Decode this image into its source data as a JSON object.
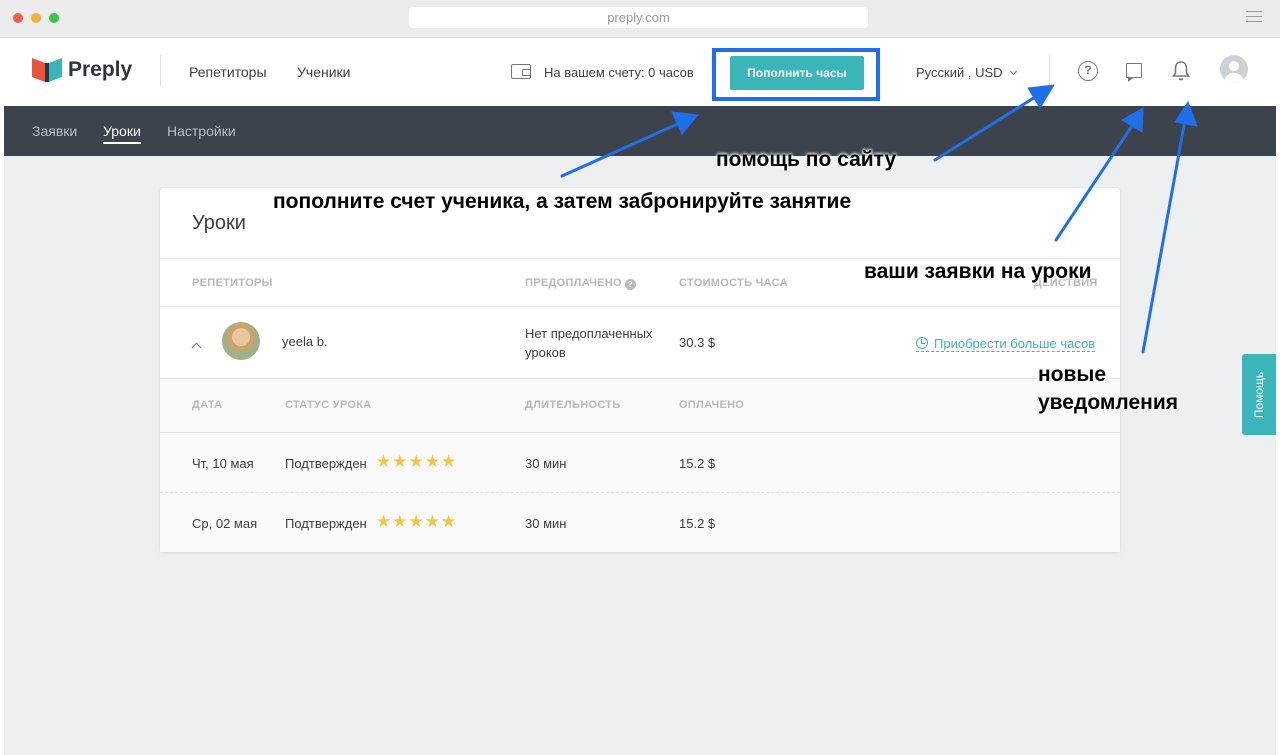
{
  "browser": {
    "url": "preply.com"
  },
  "header": {
    "logo_text": "Preply",
    "nav": [
      "Репетиторы",
      "Ученики"
    ],
    "balance_text": "На вашем счету: 0 часов",
    "topup_label": "Пополнить часы",
    "language": "Русский , USD",
    "help_symbol": "?"
  },
  "subnav": {
    "tabs": [
      {
        "label": "Заявки",
        "active": false
      },
      {
        "label": "Уроки",
        "active": true
      },
      {
        "label": "Настройки",
        "active": false
      }
    ]
  },
  "lessons": {
    "title": "Уроки",
    "columns": {
      "tutors": "РЕПЕТИТОРЫ",
      "prepaid": "ПРЕДОПЛАЧЕНО",
      "hour_cost": "СТОИМОСТЬ ЧАСА",
      "actions": "ДЕЙСТВИЯ"
    },
    "tutor": {
      "name": "yeela b.",
      "prepaid": "Нет предоплаченных уроков",
      "hour_cost": "30.3 $",
      "action": "Приобрести больше часов"
    },
    "sub_columns": {
      "date": "ДАТА",
      "status": "СТАТУС УРОКА",
      "duration": "ДЛИТЕЛЬНОСТЬ",
      "paid": "ОПЛАЧЕНО"
    },
    "rows": [
      {
        "date": "Чт, 10 мая",
        "status": "Подтвержден",
        "rating": 5,
        "duration": "30 мин",
        "paid": "15.2 $"
      },
      {
        "date": "Ср, 02 мая",
        "status": "Подтвержден",
        "rating": 5,
        "duration": "30 мин",
        "paid": "15.2 $"
      }
    ]
  },
  "help_tab": "Помощь",
  "annotations": {
    "site_help": "помощь по сайту",
    "topup_then_book": "пополните счет ученика, а затем забронируйте занятие",
    "requests": "ваши заявки на уроки",
    "notifications_1": "новые",
    "notifications_2": "уведомления"
  },
  "colors": {
    "accent": "#3ab5b9",
    "subnav_bg": "#3c434d",
    "highlight": "#1e6fe8",
    "arrow": "#1e6fe8",
    "star": "#f4c542"
  }
}
